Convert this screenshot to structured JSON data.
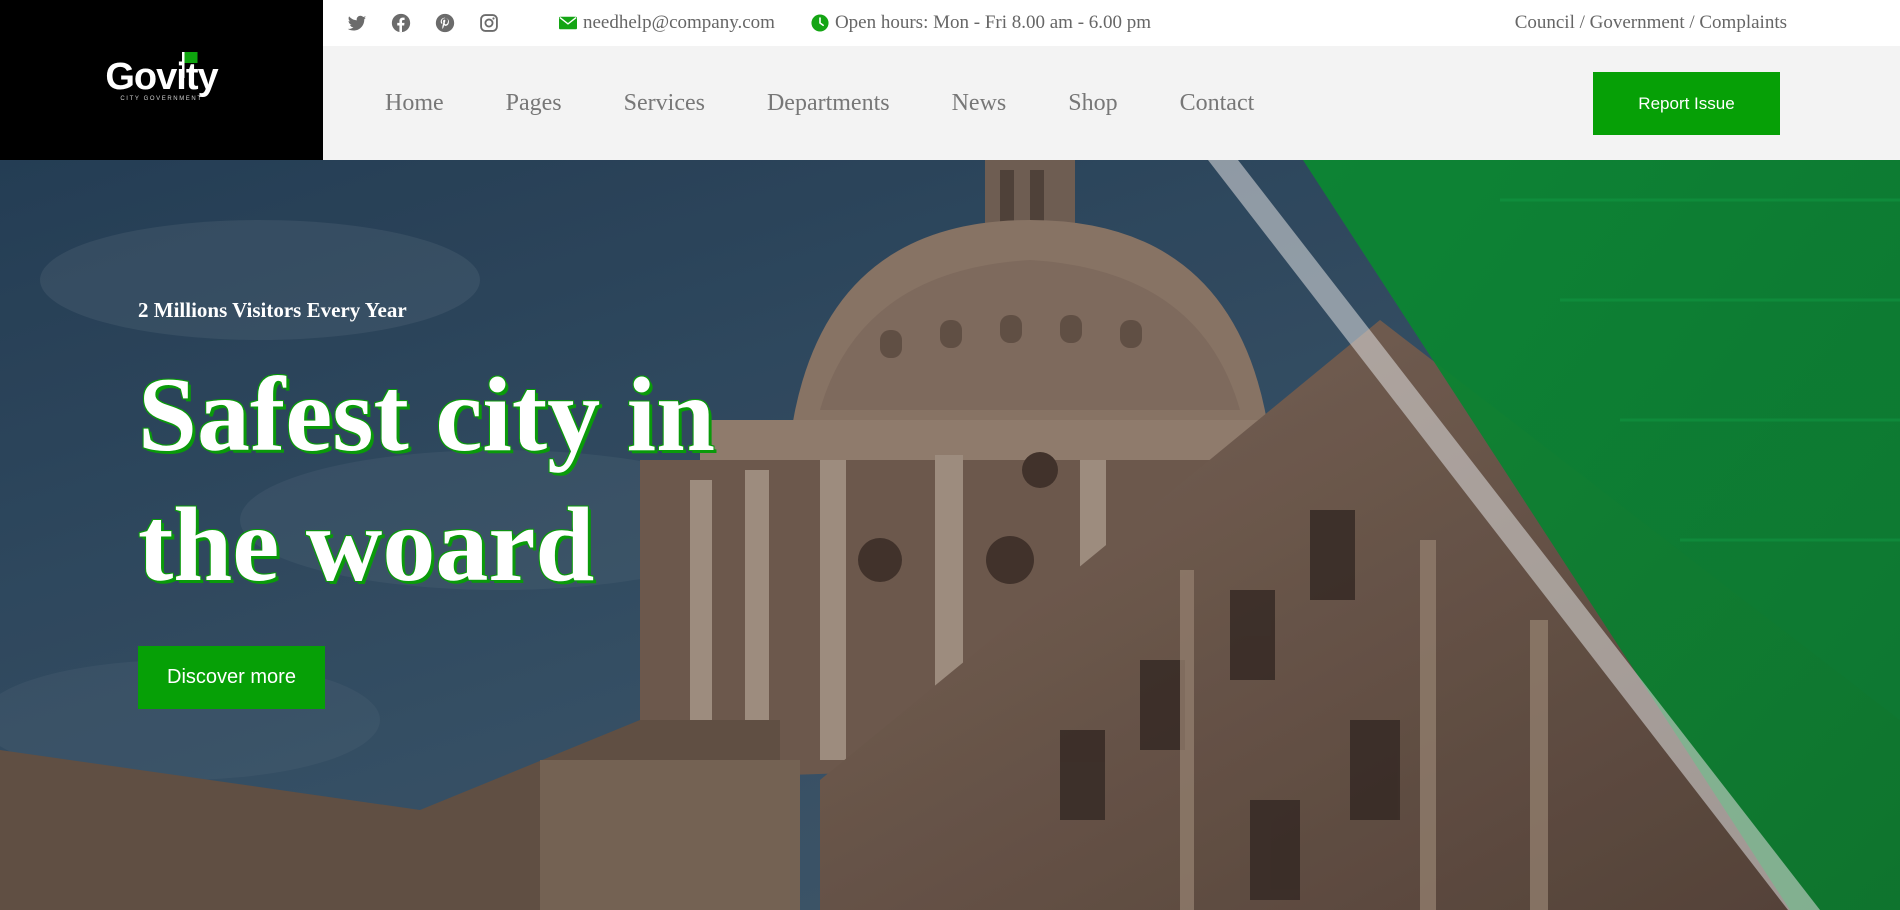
{
  "brand": {
    "name": "Govity",
    "tagline": "CITY GOVERNMENT"
  },
  "topbar": {
    "social": [
      {
        "icon": "twitter-icon"
      },
      {
        "icon": "facebook-icon"
      },
      {
        "icon": "pinterest-icon"
      },
      {
        "icon": "instagram-icon"
      }
    ],
    "email": "needhelp@company.com",
    "hours": "Open hours: Mon - Fri 8.00 am - 6.00 pm",
    "breadcrumb": "Council / Government / Complaints"
  },
  "nav": {
    "items": [
      "Home",
      "Pages",
      "Services",
      "Departments",
      "News",
      "Shop",
      "Contact"
    ],
    "report_button": "Report Issue"
  },
  "hero": {
    "subtitle": "2 Millions Visitors Every Year",
    "title": "Safest city in the woard",
    "button": "Discover more"
  },
  "colors": {
    "accent": "#06a006",
    "logo_bg": "#000000",
    "nav_bg": "#f3f3f3"
  }
}
